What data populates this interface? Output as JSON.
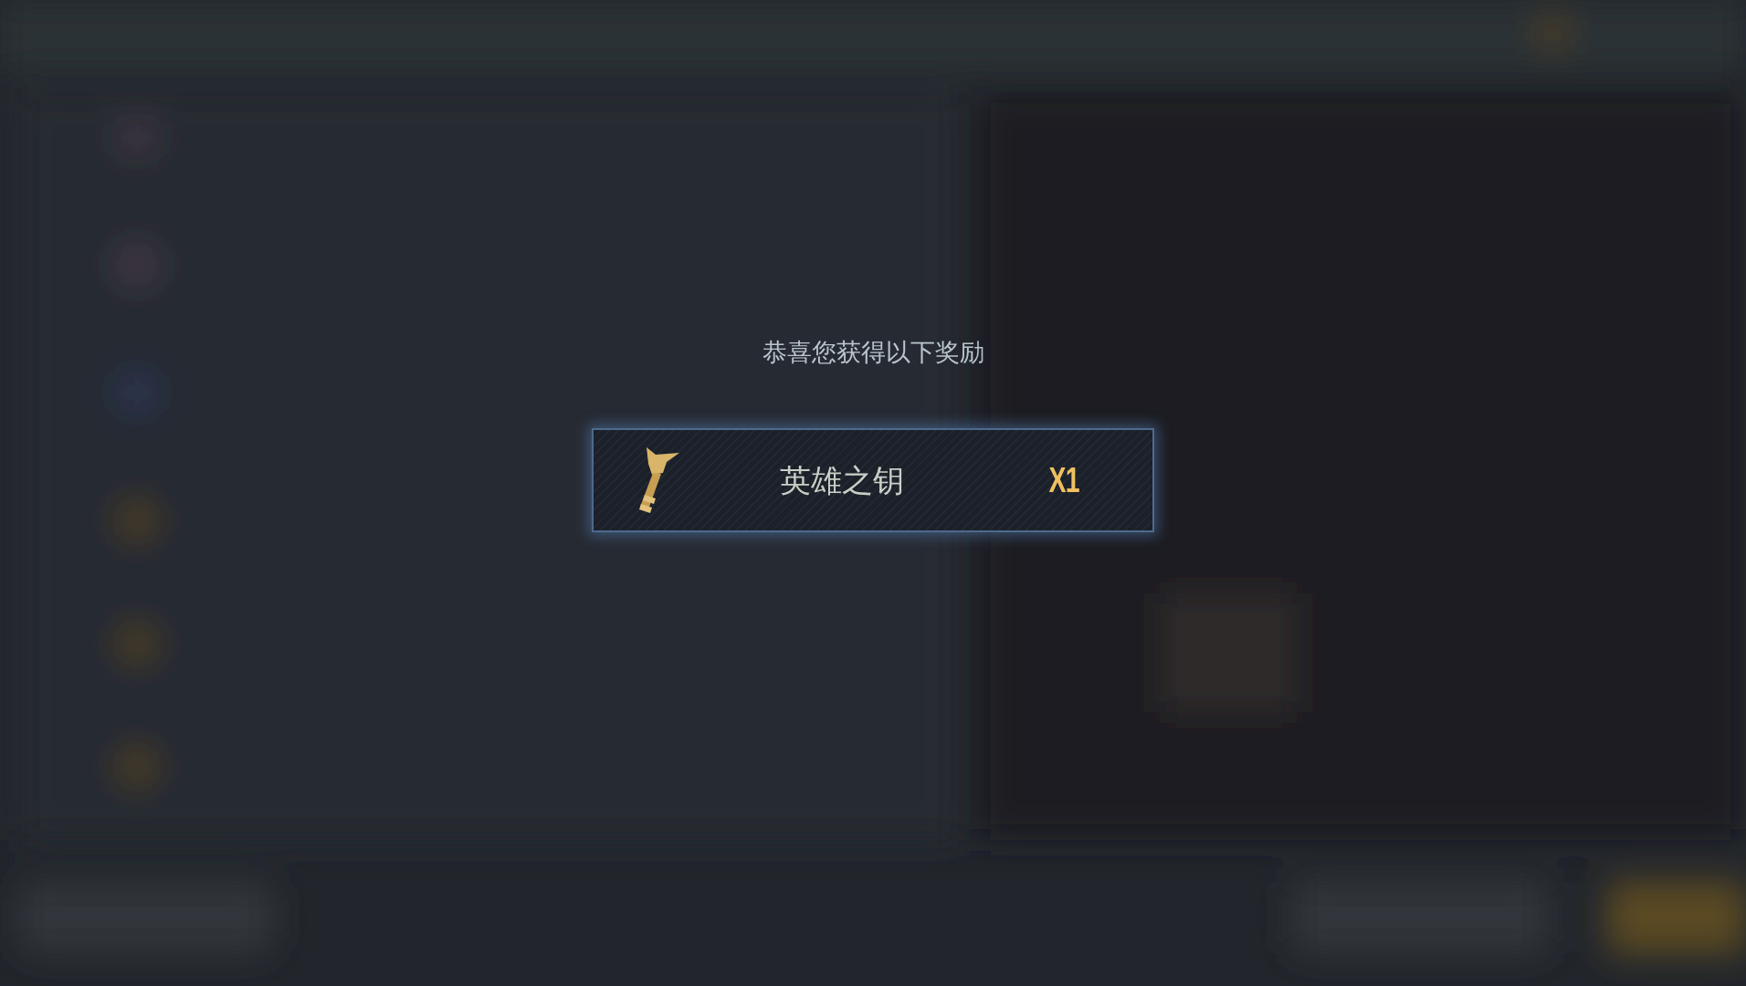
{
  "title": "恭喜您获得以下奖励",
  "rewards": [
    {
      "name": "英雄之钥",
      "quantity": "X1"
    }
  ]
}
